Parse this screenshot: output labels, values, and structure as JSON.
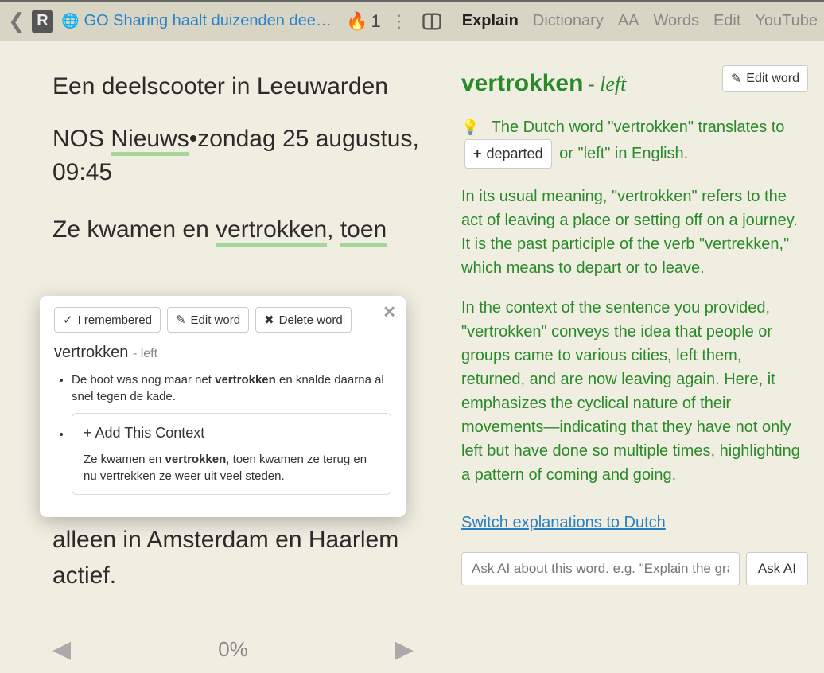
{
  "header": {
    "title": "GO Sharing haalt duizenden deelsco…",
    "streak": "1"
  },
  "menu": {
    "explain": "Explain",
    "dictionary": "Dictionary",
    "aa": "AA",
    "words": "Words",
    "edit": "Edit",
    "youtube": "YouTube"
  },
  "article": {
    "caption": "Een deelscooter in Leeuwarden",
    "source_prefix": "NOS ",
    "source_word": "Nieuws",
    "date": "•zondag 25 augustus, 09:45",
    "s1_a": "Ze kwamen en ",
    "s1_b": "vertrokken",
    "s1_c": ", ",
    "s1_d": "toen",
    "after": "naar Spanje. Het bedrijf blijft alleen in Amsterdam en Haarlem actief.",
    "progress": "0%"
  },
  "popup": {
    "remembered": "I remembered",
    "edit": "Edit word",
    "delete": "Delete word",
    "word": "vertrokken",
    "trans": "- left",
    "ex1_a": "De boot was nog maar net ",
    "ex1_b": "vertrokken",
    "ex1_c": " en knalde daarna al snel tegen de kade.",
    "ctx_title": "+ Add This Context",
    "ctx_a": "Ze kwamen en ",
    "ctx_b": "vertrokken",
    "ctx_c": ", toen kwamen ze terug en nu vertrekken ze weer uit veel steden."
  },
  "explain": {
    "word": "vertrokken",
    "trans": "- left",
    "edit_btn": "Edit word",
    "intro_a": "The Dutch word \"vertrokken\" translates to",
    "chip": "departed",
    "intro_b": "or \"left\" in English.",
    "p1": "In its usual meaning, \"vertrokken\" refers to the act of leaving a place or setting off on a journey. It is the past participle of the verb \"vertrekken,\" which means to depart or to leave.",
    "p2": "In the context of the sentence you provided, \"vertrokken\" conveys the idea that people or groups came to various cities, left them, returned, and are now leaving again. Here, it emphasizes the cyclical nature of their movements—indicating that they have not only left but have done so multiple times, highlighting a pattern of coming and going.",
    "switch": "Switch explanations to Dutch",
    "ask_placeholder": "Ask AI about this word. e.g. \"Explain the grammar\"",
    "ask_btn": "Ask AI"
  }
}
